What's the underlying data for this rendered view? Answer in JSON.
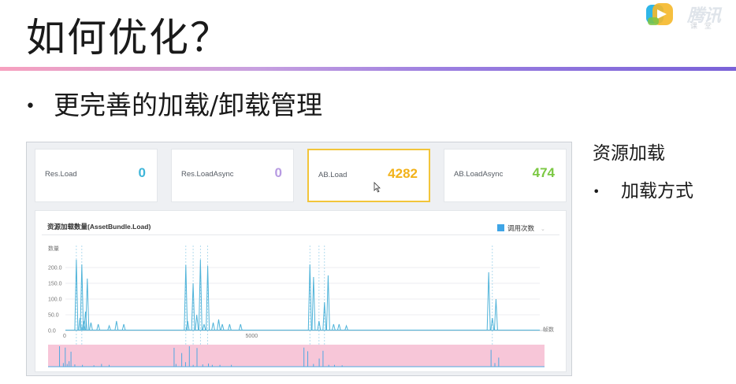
{
  "slide": {
    "title": "如何优化？",
    "bullet": "更完善的加载/卸载管理",
    "bullet_marker": "•",
    "side_heading": "资源加载",
    "side_bullet": "加载方式",
    "side_marker": "•"
  },
  "logo": {
    "icon": "play-logo-icon",
    "text": "腾讯",
    "sub": "课 堂"
  },
  "dashboard": {
    "cards": [
      {
        "label": "Res.Load",
        "value": "0",
        "color": "#3fb6d9"
      },
      {
        "label": "Res.LoadAsync",
        "value": "0",
        "color": "#b79ae2"
      },
      {
        "label": "AB.Load",
        "value": "4282",
        "color": "#f2b21a",
        "selected": true
      },
      {
        "label": "AB.LoadAsync",
        "value": "474",
        "color": "#7bc843"
      }
    ],
    "panel_title": "资源加载数量(AssetBundle.Load)",
    "legend_label": "调用次数",
    "legend_color": "#3fa5e6",
    "legend_chevron": "⌄"
  },
  "chart_data": {
    "type": "line",
    "ylabel": "数量",
    "xlabel": "帧数",
    "y_ticks": [
      "200.0",
      "150.0",
      "100.0",
      "50.0",
      "0.0"
    ],
    "ylim": [
      0,
      225
    ],
    "x_ticks": [
      "0",
      "5000"
    ],
    "xlim": [
      0,
      13000
    ],
    "line_color": "#4fb3d9",
    "x": [
      300,
      400,
      450,
      500,
      550,
      600,
      700,
      900,
      1200,
      1400,
      1600,
      3300,
      3350,
      3500,
      3600,
      3700,
      3800,
      3900,
      4050,
      4200,
      4300,
      4500,
      4800,
      6700,
      6800,
      6950,
      7100,
      7200,
      7350,
      7500,
      7700,
      11600,
      11700,
      11800
    ],
    "y": [
      225,
      40,
      210,
      30,
      60,
      165,
      25,
      20,
      15,
      30,
      20,
      208,
      30,
      150,
      50,
      225,
      20,
      205,
      25,
      35,
      20,
      20,
      20,
      210,
      170,
      30,
      90,
      175,
      20,
      20,
      15,
      185,
      40,
      100
    ]
  }
}
